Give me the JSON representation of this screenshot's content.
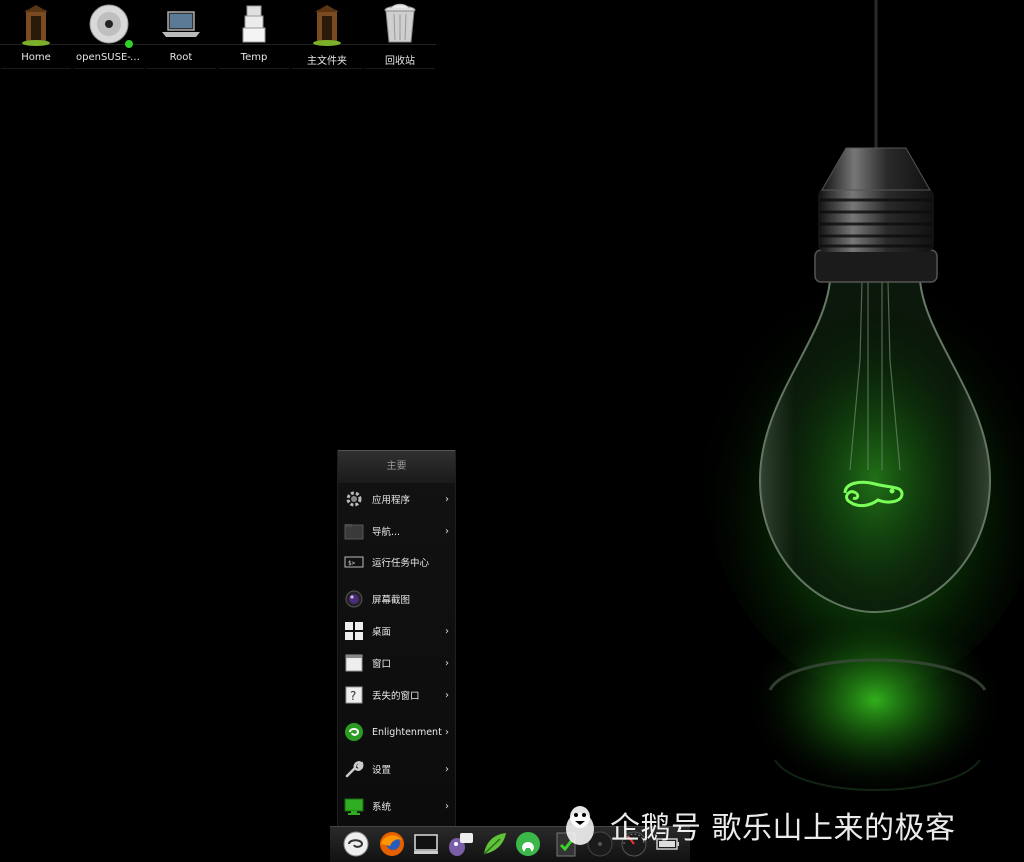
{
  "desktop": {
    "icons": [
      {
        "label": "Home",
        "icon": "outhouse-icon"
      },
      {
        "label": "openSUSE-Tu…",
        "icon": "cd-disc-icon"
      },
      {
        "label": "Root",
        "icon": "laptop-icon"
      },
      {
        "label": "Temp",
        "icon": "box-stack-icon"
      },
      {
        "label": "主文件夹",
        "icon": "outhouse-icon"
      },
      {
        "label": "回收站",
        "icon": "trash-icon"
      }
    ]
  },
  "menu": {
    "title": "主要",
    "items": [
      {
        "label": "应用程序",
        "icon": "gear-icon",
        "submenu": true
      },
      {
        "label": "导航...",
        "icon": "folder-icon",
        "submenu": true
      },
      {
        "label": "运行任务中心",
        "icon": "terminal-icon",
        "submenu": false
      },
      {
        "label": "屏幕截图",
        "icon": "camera-lens-icon",
        "submenu": false
      },
      {
        "label": "桌面",
        "icon": "desktop-grid-icon",
        "submenu": true
      },
      {
        "label": "窗口",
        "icon": "window-icon",
        "submenu": true
      },
      {
        "label": "丢失的窗口",
        "icon": "question-window-icon",
        "submenu": true
      },
      {
        "label": "Enlightenment",
        "icon": "enlightenment-logo-icon",
        "submenu": true
      },
      {
        "label": "设置",
        "icon": "wrench-icon",
        "submenu": true
      },
      {
        "label": "系统",
        "icon": "system-monitor-icon",
        "submenu": true
      }
    ],
    "arrow": "›"
  },
  "taskbar": {
    "icons": [
      "opensuse-start-icon",
      "firefox-icon",
      "terminal-icon",
      "pidgin-icon",
      "leafpad-icon",
      "file-manager-icon",
      "clipboard-check-icon",
      "clock-icon",
      "gauge-icon",
      "battery-icon"
    ]
  },
  "watermark": {
    "text": "企鹅号 歌乐山上来的极客",
    "icon": "penguin-icon"
  },
  "colors": {
    "accent": "#3cd22a",
    "background": "#000000"
  }
}
